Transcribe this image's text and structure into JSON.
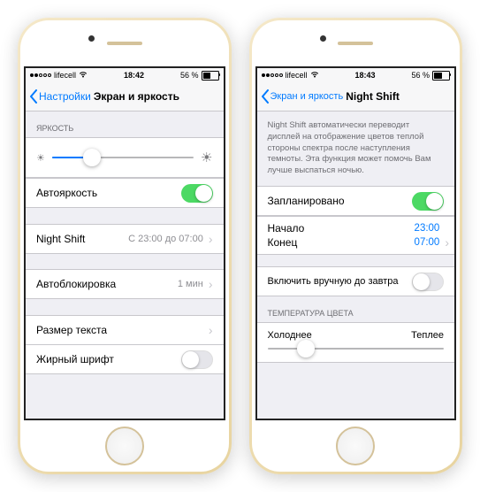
{
  "phone1": {
    "status": {
      "dots_filled": 2,
      "carrier": "lifecell",
      "time": "18:42",
      "battery_pct": "56 %",
      "battery_fill": "56%"
    },
    "nav": {
      "back": "Настройки",
      "title": "Экран и яркость"
    },
    "brightness": {
      "header": "ЯРКОСТЬ",
      "slider_pct": 28
    },
    "auto_brightness": {
      "label": "Автояркость",
      "on": true
    },
    "night_shift": {
      "label": "Night Shift",
      "detail": "С 23:00 до 07:00"
    },
    "auto_lock": {
      "label": "Автоблокировка",
      "detail": "1 мин"
    },
    "text_size": {
      "label": "Размер текста"
    },
    "bold_text": {
      "label": "Жирный шрифт",
      "on": false
    }
  },
  "phone2": {
    "status": {
      "dots_filled": 2,
      "carrier": "lifecell",
      "time": "18:43",
      "battery_pct": "56 %",
      "battery_fill": "56%"
    },
    "nav": {
      "back": "Экран и яркость",
      "title": "Night Shift"
    },
    "desc": "Night Shift автоматически переводит дисплей на отображение цветов теплой стороны спектра после наступления темноты. Эта функция может помочь Вам лучше выспаться ночью.",
    "scheduled": {
      "label": "Запланировано",
      "on": true
    },
    "from": {
      "label": "Начало",
      "value": "23:00"
    },
    "to": {
      "label": "Конец",
      "value": "07:00"
    },
    "manual": {
      "label": "Включить вручную до завтра",
      "on": false
    },
    "temp": {
      "header": "ТЕМПЕРАТУРА ЦВЕТА",
      "cold": "Холоднее",
      "warm": "Теплее",
      "slider_pct": 22
    }
  }
}
